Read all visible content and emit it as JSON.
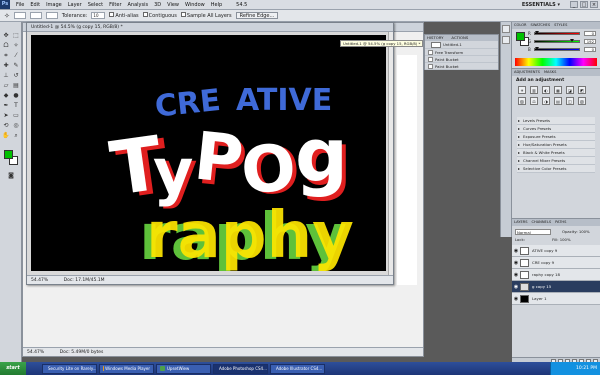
{
  "menubar": {
    "app_badge": "Ps",
    "items": [
      "File",
      "Edit",
      "Image",
      "Layer",
      "Select",
      "Filter",
      "Analysis",
      "3D",
      "View",
      "Window",
      "Help"
    ],
    "zoom": "54.5",
    "workspace": "ESSENTIALS ▾",
    "window_controls": [
      "_",
      "□",
      "×"
    ]
  },
  "options": {
    "tolerance_label": "Tolerance:",
    "tolerance_value": "10",
    "anti_alias": "Anti-alias",
    "contiguous": "Contiguous",
    "sample_all": "Sample All Layers",
    "refine_edge": "Refine Edge..."
  },
  "document_back": {
    "status": "54.47%",
    "doc_size": "Doc: 5.49M/0 bytes"
  },
  "document_front": {
    "title": "Untitled-1 @ 54.5% (g copy 15, RGB/8) *",
    "status_zoom": "54.47%",
    "doc_size": "Doc: 17.1M/45.1M"
  },
  "tooltip": "Untitled-1 @ 54.5% (g copy 15, RGB/8) *",
  "artwork": {
    "cre": "CRE",
    "ative": "ATIVE",
    "t": "T",
    "y": "y",
    "p": "P",
    "o": "O",
    "g": "g",
    "raphy": "raphy",
    "colors": {
      "blue": "#3f6ad8",
      "red": "#e01f1f",
      "white": "#ffffff",
      "green": "#5ec13a",
      "yellow": "#ffe600"
    }
  },
  "history": {
    "tabs": [
      "HISTORY",
      "ACTIONS"
    ],
    "snapshot": "Untitled-1",
    "items": [
      "Free Transform",
      "Paint Bucket",
      "Paint Bucket"
    ]
  },
  "color_panel": {
    "tabs": [
      "COLOR",
      "SWATCHES",
      "STYLES"
    ],
    "r_label": "R",
    "g_label": "G",
    "b_label": "B",
    "r_value": "0",
    "g_value": "192",
    "b_value": "0",
    "fg": "#00c000",
    "bg": "#ffffff"
  },
  "adjustments": {
    "tabs": [
      "ADJUSTMENTS",
      "MASKS"
    ],
    "title": "Add an adjustment",
    "icons": [
      "☀",
      "▥",
      "◐",
      "▦",
      "◪",
      "◩",
      "▨",
      "⚖",
      "◑",
      "▤",
      "◫",
      "▧"
    ],
    "presets": [
      "Levels Presets",
      "Curves Presets",
      "Exposure Presets",
      "Hue/Saturation Presets",
      "Black & White Presets",
      "Channel Mixer Presets",
      "Selective Color Presets"
    ]
  },
  "layers": {
    "tabs": [
      "LAYERS",
      "CHANNELS",
      "PATHS"
    ],
    "blend_mode": "Normal",
    "opacity_label": "Opacity: 100%",
    "lock_label": "Lock:",
    "fill_label": "Fill: 100%",
    "rows": [
      {
        "name": "ATIVE copy 9",
        "selected": false
      },
      {
        "name": "CRE copy 9",
        "selected": false
      },
      {
        "name": "raphy copy 18",
        "selected": false
      },
      {
        "name": "g copy 15",
        "selected": true
      },
      {
        "name": "Layer 1",
        "selected": false
      }
    ]
  },
  "taskbar": {
    "start": "start",
    "items": [
      {
        "label": "Security Lite on Rarely...",
        "color": "#c8502a"
      },
      {
        "label": "Windows Media Player",
        "color": "#e59b1a"
      },
      {
        "label": "UpsetWiew",
        "color": "#4da04a"
      },
      {
        "label": "Adobe Photoshop CS4...",
        "color": "#1b66c9"
      },
      {
        "label": "Adobe Illustrator CS4...",
        "color": "#e08a1c"
      }
    ],
    "clock": "10:21 PM"
  }
}
